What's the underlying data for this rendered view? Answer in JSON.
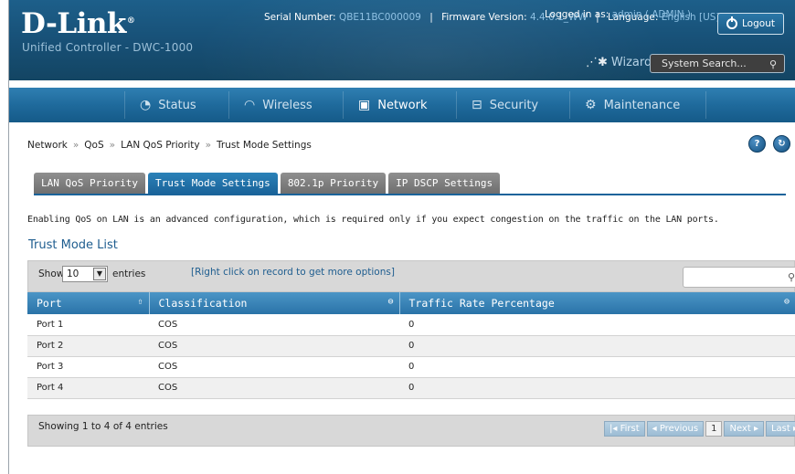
{
  "brand": {
    "logo": "D-Link",
    "reg": "®",
    "product": "Unified Controller - DWC-1000"
  },
  "header": {
    "serial_label": "Serial Number:",
    "serial": "QBE11BC000009",
    "firmware_label": "Firmware Version:",
    "firmware": "4.4.0.1_WW",
    "language_label": "Language:",
    "language": "English [US]",
    "logged_label": "Logged in as:",
    "logged_user": "admin ( ADMIN )",
    "logout": "Logout",
    "wizard": "Wizard",
    "search_placeholder": "System Search..."
  },
  "nav": [
    {
      "label": "Status",
      "icon": "status-icon"
    },
    {
      "label": "Wireless",
      "icon": "wireless-icon"
    },
    {
      "label": "Network",
      "icon": "network-icon"
    },
    {
      "label": "Security",
      "icon": "lock-icon"
    },
    {
      "label": "Maintenance",
      "icon": "gears-icon"
    }
  ],
  "breadcrumb": [
    "Network",
    "QoS",
    "LAN QoS Priority",
    "Trust Mode Settings"
  ],
  "tabs": [
    "LAN QoS Priority",
    "Trust Mode Settings",
    "802.1p Priority",
    "IP DSCP Settings"
  ],
  "active_tab": "Trust Mode Settings",
  "description": "Enabling QoS on LAN is an advanced configuration, which is required only if you expect congestion on the traffic on the LAN ports.",
  "list_title": "Trust Mode List",
  "table": {
    "show_label": "Show",
    "show_value": "10",
    "entries_label": "entries",
    "hint": "[Right click on record to get more options]",
    "columns": [
      "Port",
      "Classification",
      "Traffic Rate Percentage"
    ],
    "rows": [
      [
        "Port 1",
        "COS",
        "0"
      ],
      [
        "Port 2",
        "COS",
        "0"
      ],
      [
        "Port 3",
        "COS",
        "0"
      ],
      [
        "Port 4",
        "COS",
        "0"
      ]
    ],
    "showing": "Showing 1 to 4 of 4 entries",
    "pager": {
      "first": "First",
      "previous": "Previous",
      "current": "1",
      "next": "Next",
      "last": "Last"
    }
  }
}
